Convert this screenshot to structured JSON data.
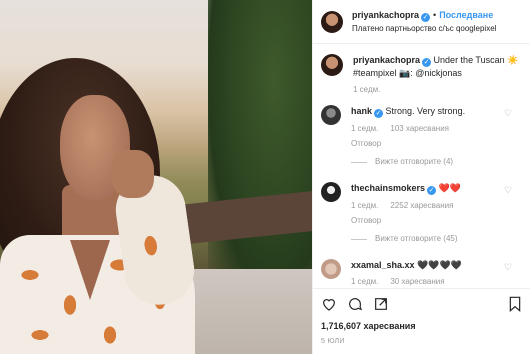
{
  "post": {
    "author": "priyankachopra",
    "follow_label": "Последване",
    "dot": "•",
    "sponsor_text": "Платено партньорство с/ъс qooglepixel",
    "caption_user": "priyankachopra",
    "caption_text": "Under the Tuscan ☀️ #teampixel 📷: @nickjonas",
    "caption_time": "1 седм."
  },
  "comments": [
    {
      "user": "hank",
      "verified": true,
      "text": "Strong. Very strong.",
      "time": "1 седм.",
      "likes": "103 харесвания",
      "reply": "Отговор",
      "view": "Вижте отговорите (4)"
    },
    {
      "user": "thechainsmokers",
      "verified": true,
      "text": "❤️❤️",
      "time": "1 седм.",
      "likes": "2252 харесвания",
      "reply": "Отговор",
      "view": "Вижте отговорите (45)"
    },
    {
      "user": "xxamal_sha.xx",
      "verified": false,
      "text": "🖤🖤🖤🖤",
      "time": "1 седм.",
      "likes": "30 харесвания"
    }
  ],
  "footer": {
    "likes": "1,716,607 харесвания",
    "date": "5 ЮЛИ"
  },
  "icons": [
    "heart-icon",
    "comment-icon",
    "share-icon",
    "bookmark-icon",
    "verified-icon"
  ],
  "colors": {
    "accent": "#3897f0",
    "heart_red": "#ed4956",
    "muted": "#999999"
  }
}
